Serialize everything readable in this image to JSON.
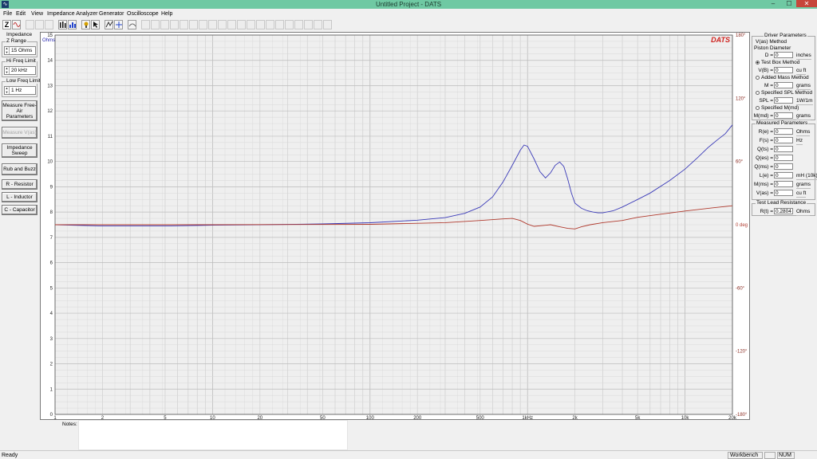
{
  "window": {
    "title": "Untitled Project - DATS",
    "min_glyph": "–",
    "max_glyph": "☐",
    "close_glyph": "✕"
  },
  "menu": [
    "File",
    "Edit",
    "View",
    "Impedance Analyzer",
    "Generator",
    "Oscilloscope",
    "Help"
  ],
  "left_panel": {
    "impedance_caption": "Impedance",
    "z_range_caption": "Z Range",
    "z_range_value": "15 Ohms",
    "hi_freq_caption": "Hi Freq Limit",
    "hi_freq_value": "20 kHz",
    "low_freq_caption": "Low Freq Limit",
    "low_freq_value": "1 Hz",
    "buttons": {
      "measure_free_air": "Measure Free-Air Parameters",
      "measure_vas": "Measure V(as)",
      "impedance_sweep": "Impedance Sweep",
      "rub_and_buzz": "Rub and Buzz",
      "r_resistor": "R - Resistor",
      "l_inductor": "L - Inductor",
      "c_capacitor": "C - Capacitor"
    }
  },
  "driver_params": {
    "caption": "Driver Parameters",
    "vas_method_caption": "V(as) Method",
    "piston_caption": "Piston Diameter",
    "d_label": "D =",
    "d_value": "0",
    "d_unit": "inches",
    "test_box": "Test Box Method",
    "vb_label": "V(B) =",
    "vb_value": "0",
    "vb_unit": "cu ft",
    "added_mass": "Added Mass Method",
    "m_label": "M =",
    "m_value": "0",
    "m_unit": "grams",
    "specified_spl": "Specified SPL Method",
    "spl_label": "SPL =",
    "spl_value": "0",
    "spl_unit": "1W/1m",
    "specified_mmd": "Specified M(md)",
    "mmd_label": "M(md) =",
    "mmd_value": "0",
    "mmd_unit": "grams"
  },
  "measured": {
    "caption": "Measured Parameters",
    "rows": [
      {
        "label": "R(e) =",
        "value": "0",
        "unit": "Ohms"
      },
      {
        "label": "F(s) =",
        "value": "0",
        "unit": "Hz"
      },
      {
        "label": "Q(ts) =",
        "value": "0",
        "unit": ""
      },
      {
        "label": "Q(es) =",
        "value": "0",
        "unit": ""
      },
      {
        "label": "Q(ms) =",
        "value": "0",
        "unit": ""
      },
      {
        "label": "L(e) =",
        "value": "0",
        "unit": "mH (10k)"
      },
      {
        "label": "M(ms) =",
        "value": "0",
        "unit": "grams"
      },
      {
        "label": "V(as) =",
        "value": "0",
        "unit": "cu ft"
      }
    ]
  },
  "test_lead": {
    "caption": "Test Lead Resistance",
    "label": "R(t) =",
    "value": "0.2804",
    "unit": "Ohms"
  },
  "notes": {
    "label": "Notes:",
    "value": ""
  },
  "status": {
    "left": "Ready",
    "workbench": "Workbench",
    "num": "NUM"
  },
  "chart_data": {
    "type": "line",
    "brand": "DATS",
    "ylabel": "Ohms",
    "x_scale": "log",
    "xlim": [
      1,
      20000
    ],
    "ylim": [
      0,
      15
    ],
    "y2lim": [
      -180,
      180
    ],
    "grid": true,
    "x_ticks": [
      1,
      2,
      5,
      10,
      20,
      50,
      100,
      200,
      500,
      1000,
      2000,
      5000,
      10000,
      20000
    ],
    "x_tick_labels": [
      "1",
      "2",
      "5",
      "10",
      "20",
      "50",
      "100",
      "200",
      "500",
      "1kHz",
      "2k",
      "5k",
      "10k",
      "20k"
    ],
    "y_ticks": [
      0,
      1,
      2,
      3,
      4,
      5,
      6,
      7,
      8,
      9,
      10,
      11,
      12,
      13,
      14,
      15
    ],
    "y2_ticks": [
      180,
      120,
      60,
      0,
      -60,
      -120,
      -180
    ],
    "y2_tick_labels": [
      "180°",
      "120°",
      "60°",
      "0 deg",
      "-60°",
      "-120°",
      "-180°"
    ],
    "series": [
      {
        "color": "#3a3ab8",
        "axis": "left",
        "x": [
          1,
          2,
          5,
          10,
          20,
          50,
          100,
          200,
          300,
          400,
          500,
          600,
          700,
          800,
          900,
          950,
          1000,
          1100,
          1200,
          1300,
          1400,
          1500,
          1600,
          1700,
          1800,
          1900,
          2000,
          2200,
          2400,
          2600,
          2800,
          3000,
          3500,
          4000,
          5000,
          6000,
          8000,
          10000,
          12000,
          14000,
          16000,
          18000,
          20000
        ],
        "values": [
          7.5,
          7.45,
          7.45,
          7.48,
          7.5,
          7.53,
          7.58,
          7.68,
          7.78,
          7.95,
          8.2,
          8.6,
          9.2,
          9.85,
          10.45,
          10.65,
          10.6,
          10.1,
          9.6,
          9.35,
          9.55,
          9.85,
          9.98,
          9.8,
          9.3,
          8.75,
          8.35,
          8.15,
          8.05,
          8.0,
          7.97,
          7.97,
          8.05,
          8.2,
          8.5,
          8.75,
          9.25,
          9.7,
          10.15,
          10.55,
          10.85,
          11.1,
          11.45
        ]
      },
      {
        "color": "#b03a2e",
        "axis": "right",
        "x": [
          1,
          10,
          100,
          300,
          500,
          700,
          800,
          900,
          1000,
          1100,
          1300,
          1400,
          1600,
          1800,
          2000,
          2200,
          2500,
          3000,
          4000,
          5000,
          7000,
          10000,
          15000,
          20000
        ],
        "values": [
          0,
          0,
          0.4,
          2,
          4,
          5.5,
          6,
          4,
          0.5,
          -1.5,
          -0.5,
          0,
          -2,
          -3.5,
          -4,
          -2,
          0,
          2,
          4,
          7,
          10,
          13,
          16,
          18
        ]
      }
    ]
  }
}
